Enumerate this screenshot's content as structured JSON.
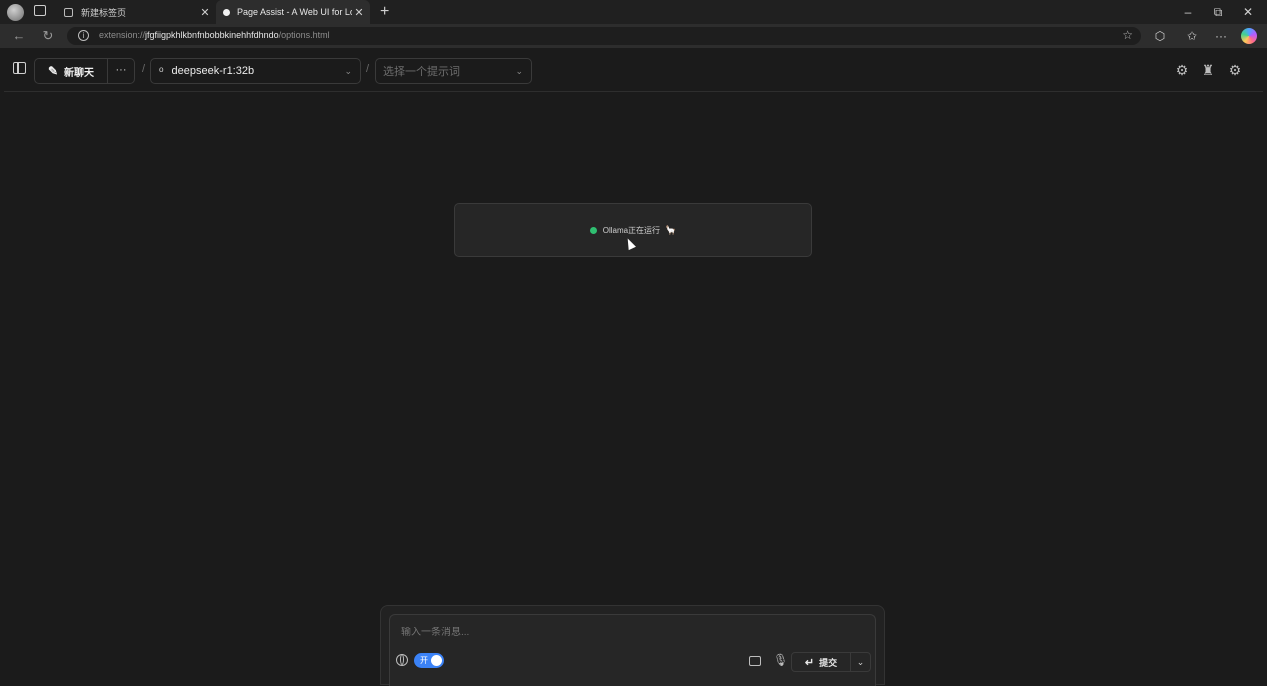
{
  "browser": {
    "tabs": [
      {
        "title": "新建标签页",
        "close": "✕"
      },
      {
        "title": "Page Assist - A Web UI for Local AI",
        "close": "✕"
      }
    ],
    "new_tab": "+",
    "window_controls": {
      "minimize": "–",
      "restore": "⧉",
      "close": "✕"
    },
    "url_prefix": "extension://",
    "url_host": "jfgfiigpkhlkbnfnbobbkinehhfdhndo",
    "url_path": "/options.html"
  },
  "app": {
    "new_chat_label": "新聊天",
    "more_label": "···",
    "separator": "/",
    "model_selected": "deepseek-r1:32b",
    "prompt_placeholder": "选择一个提示词",
    "status_text": "Ollama正在运行",
    "status_color": "#2fbf71",
    "input_placeholder": "输入一条消息...",
    "web_search_toggle": "开",
    "submit_label": "提交",
    "accent_color": "#3b82f6"
  }
}
